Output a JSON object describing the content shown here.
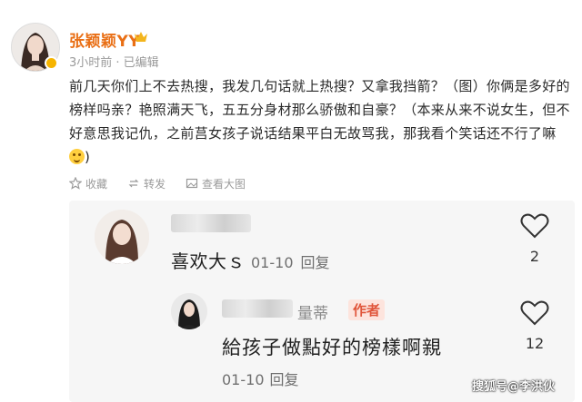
{
  "post": {
    "author": "张颖颖YY",
    "meta": "3小时前 · 已编辑",
    "body": "前几天你们上不去热搜，我发几句话就上热搜？又拿我挡箭？（图）你俩是多好的榜样吗亲？艳照满天飞，五五分身材那么骄傲和自豪？（本来从来不说女生，但不好意思我记仇，之前莒女孩子说话结果平白无故骂我，那我看个笑话还不行了嘛",
    "body_end": ")",
    "actions": {
      "favorite": "收藏",
      "repost": "转发",
      "view_image": "查看大图"
    }
  },
  "comments": [
    {
      "text": "喜欢大ｓ",
      "date": "01-10",
      "reply": "回复",
      "likes": "2"
    },
    {
      "name_visible": "量蒂",
      "badge": "作者",
      "text": "給孩子做點好的榜樣啊親",
      "date": "01-10",
      "reply": "回复",
      "likes": "12"
    }
  ],
  "watermark": "搜狐号@李洪伙",
  "colors": {
    "author_name": "#e96f15",
    "badge_text": "#e0553a",
    "badge_bg": "#fde4dd",
    "quote_bg": "#f6f6f6"
  }
}
